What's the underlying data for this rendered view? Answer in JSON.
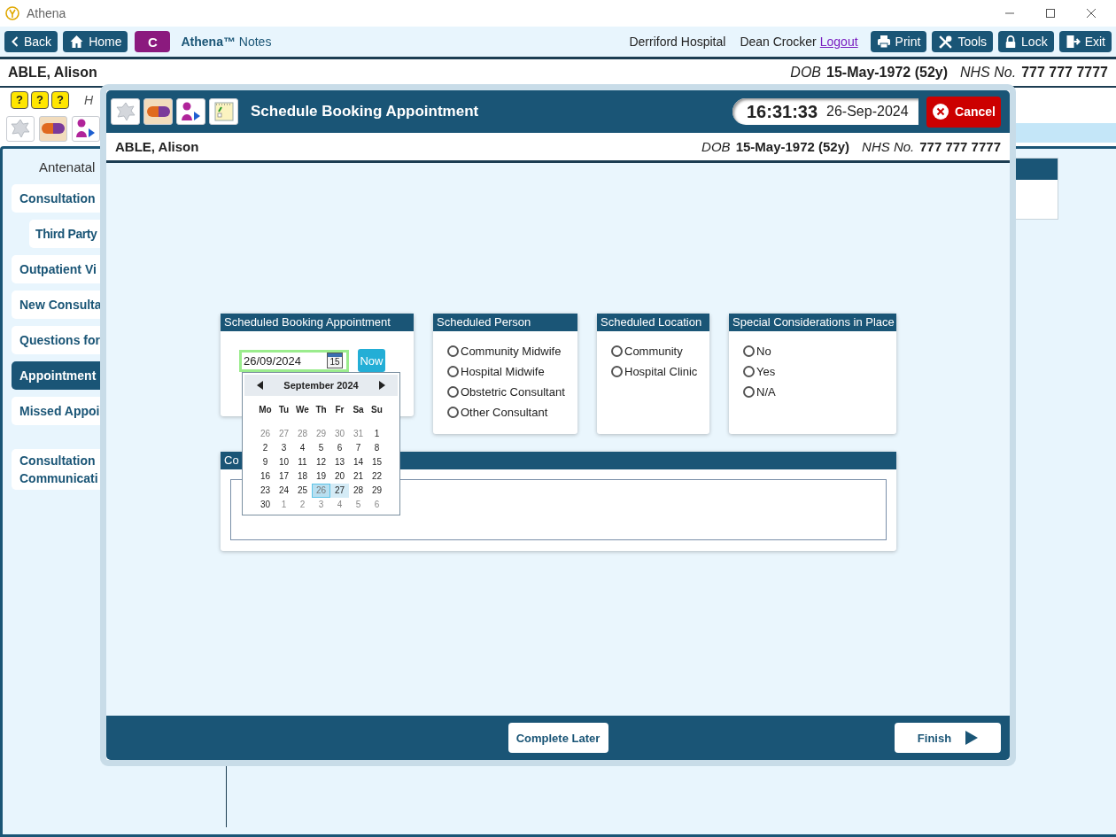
{
  "app": {
    "title": "Athena"
  },
  "toolbar": {
    "left_buttons": [
      {
        "label": "Back"
      },
      {
        "label": "Home"
      }
    ],
    "module_badge": "C",
    "brand": "**Athena™** Notes",
    "site": "Derriford Hospital",
    "user": "Dean Crocker",
    "logout": "Logout",
    "right_buttons": [
      {
        "label": "Print"
      },
      {
        "label": "Tools"
      },
      {
        "label": "Lock"
      },
      {
        "label": "Exit"
      }
    ]
  },
  "patient": {
    "name": "ABLE, Alison",
    "dob_label": "DOB",
    "dob": "15-May-1972 (52y)",
    "nhs_label": "NHS No.",
    "nhs": "777 777 7777"
  },
  "subheader": {
    "help_buttons": [
      "?",
      "?",
      "?"
    ],
    "text": "H"
  },
  "sidebar": {
    "heading": "Antenatal",
    "groups": [
      [
        {
          "label": "Consultation",
          "selected": false,
          "children": [
            {
              "label": "Third Party",
              "selected": false
            }
          ]
        },
        {
          "label": "Outpatient Vi",
          "selected": false
        },
        {
          "label": "New Consulta",
          "selected": false
        },
        {
          "label": "Questions for",
          "selected": false
        },
        {
          "label": "Appointment",
          "selected": true
        },
        {
          "label": "Missed Appoi",
          "selected": false
        }
      ],
      [
        {
          "label": "Consultation Communicati",
          "selected": false
        }
      ]
    ]
  },
  "modal": {
    "title": "Schedule Booking Appointment",
    "time": "16:31:33",
    "date": "26-Sep-2024",
    "cancel": "Cancel",
    "patient": {
      "name": "ABLE, Alison",
      "dob_label": "DOB",
      "dob": "15-May-1972 (52y)",
      "nhs_label": "NHS No.",
      "nhs": "777 777 7777"
    },
    "date_card": {
      "title": "Scheduled Booking Appointment",
      "value": "26/09/2024",
      "icon_text": "15",
      "now": "Now"
    },
    "radio_groups": [
      {
        "title": "Scheduled Person",
        "options": [
          {
            "label": "Community Midwife",
            "selected": false
          },
          {
            "label": "Hospital Midwife",
            "selected": false
          },
          {
            "label": "Obstetric Consultant",
            "selected": false
          },
          {
            "label": "Other Consultant",
            "selected": false
          }
        ]
      },
      {
        "title": "Scheduled Location",
        "options": [
          {
            "label": "Community",
            "selected": false
          },
          {
            "label": "Hospital Clinic",
            "selected": false
          }
        ]
      },
      {
        "title": "Special Considerations in Place",
        "options": [
          {
            "label": "No",
            "selected": false
          },
          {
            "label": "Yes",
            "selected": false
          },
          {
            "label": "N/A",
            "selected": false
          }
        ]
      }
    ],
    "comments": {
      "title": "Co"
    },
    "calendar": {
      "month": "September 2024",
      "weekdays": [
        "Mo",
        "Tu",
        "We",
        "Th",
        "Fr",
        "Sa",
        "Su"
      ],
      "weeks": [
        [
          {
            "d": "26",
            "muted": true,
            "selected": false,
            "highlighted": false
          },
          {
            "d": "27",
            "muted": true,
            "selected": false,
            "highlighted": false
          },
          {
            "d": "28",
            "muted": true,
            "selected": false,
            "highlighted": false
          },
          {
            "d": "29",
            "muted": true,
            "selected": false,
            "highlighted": false
          },
          {
            "d": "30",
            "muted": true,
            "selected": false,
            "highlighted": false
          },
          {
            "d": "31",
            "muted": true,
            "selected": false,
            "highlighted": false
          },
          {
            "d": "1",
            "muted": false,
            "selected": false,
            "highlighted": false
          }
        ],
        [
          {
            "d": "2",
            "muted": false,
            "selected": false,
            "highlighted": false
          },
          {
            "d": "3",
            "muted": false,
            "selected": false,
            "highlighted": false
          },
          {
            "d": "4",
            "muted": false,
            "selected": false,
            "highlighted": false
          },
          {
            "d": "5",
            "muted": false,
            "selected": false,
            "highlighted": false
          },
          {
            "d": "6",
            "muted": false,
            "selected": false,
            "highlighted": false
          },
          {
            "d": "7",
            "muted": false,
            "selected": false,
            "highlighted": false
          },
          {
            "d": "8",
            "muted": false,
            "selected": false,
            "highlighted": false
          }
        ],
        [
          {
            "d": "9",
            "muted": false,
            "selected": false,
            "highlighted": false
          },
          {
            "d": "10",
            "muted": false,
            "selected": false,
            "highlighted": false
          },
          {
            "d": "11",
            "muted": false,
            "selected": false,
            "highlighted": false
          },
          {
            "d": "12",
            "muted": false,
            "selected": false,
            "highlighted": false
          },
          {
            "d": "13",
            "muted": false,
            "selected": false,
            "highlighted": false
          },
          {
            "d": "14",
            "muted": false,
            "selected": false,
            "highlighted": false
          },
          {
            "d": "15",
            "muted": false,
            "selected": false,
            "highlighted": false
          }
        ],
        [
          {
            "d": "16",
            "muted": false,
            "selected": false,
            "highlighted": false
          },
          {
            "d": "17",
            "muted": false,
            "selected": false,
            "highlighted": false
          },
          {
            "d": "18",
            "muted": false,
            "selected": false,
            "highlighted": false
          },
          {
            "d": "19",
            "muted": false,
            "selected": false,
            "highlighted": false
          },
          {
            "d": "20",
            "muted": false,
            "selected": false,
            "highlighted": false
          },
          {
            "d": "21",
            "muted": false,
            "selected": false,
            "highlighted": false
          },
          {
            "d": "22",
            "muted": false,
            "selected": false,
            "highlighted": false
          }
        ],
        [
          {
            "d": "23",
            "muted": false,
            "selected": false,
            "highlighted": false
          },
          {
            "d": "24",
            "muted": false,
            "selected": false,
            "highlighted": false
          },
          {
            "d": "25",
            "muted": false,
            "selected": false,
            "highlighted": false
          },
          {
            "d": "26",
            "muted": false,
            "selected": true,
            "highlighted": false
          },
          {
            "d": "27",
            "muted": false,
            "selected": false,
            "highlighted": true
          },
          {
            "d": "28",
            "muted": false,
            "selected": false,
            "highlighted": false
          },
          {
            "d": "29",
            "muted": false,
            "selected": false,
            "highlighted": false
          }
        ],
        [
          {
            "d": "30",
            "muted": false,
            "selected": false,
            "highlighted": false
          },
          {
            "d": "1",
            "muted": true,
            "selected": false,
            "highlighted": false
          },
          {
            "d": "2",
            "muted": true,
            "selected": false,
            "highlighted": false
          },
          {
            "d": "3",
            "muted": true,
            "selected": false,
            "highlighted": false
          },
          {
            "d": "4",
            "muted": true,
            "selected": false,
            "highlighted": false
          },
          {
            "d": "5",
            "muted": true,
            "selected": false,
            "highlighted": false
          },
          {
            "d": "6",
            "muted": true,
            "selected": false,
            "highlighted": false
          }
        ]
      ]
    },
    "footer": {
      "complete_later": "Complete Later",
      "finish": "Finish"
    }
  }
}
